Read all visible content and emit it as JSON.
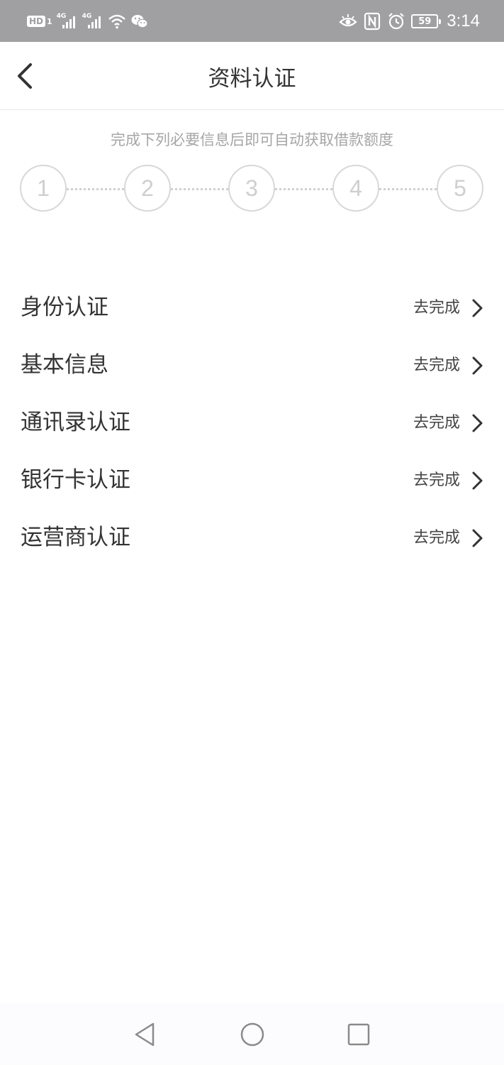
{
  "status_bar": {
    "hd_label": "HD",
    "hd_sub": "1",
    "network_1": "4G",
    "network_2": "4G",
    "battery": "59",
    "time": "3:14",
    "icons": [
      "hd-icon",
      "signal-icon",
      "signal-icon",
      "wifi-icon",
      "wechat-icon",
      "eye-icon",
      "nfc-icon",
      "alarm-icon",
      "battery-icon"
    ]
  },
  "header": {
    "title": "资料认证",
    "back_icon": "chevron-left-icon"
  },
  "hint": "完成下列必要信息后即可自动获取借款额度",
  "steps": [
    "1",
    "2",
    "3",
    "4",
    "5"
  ],
  "items": [
    {
      "label": "身份认证",
      "action": "去完成"
    },
    {
      "label": "基本信息",
      "action": "去完成"
    },
    {
      "label": "通讯录认证",
      "action": "去完成"
    },
    {
      "label": "银行卡认证",
      "action": "去完成"
    },
    {
      "label": "运营商认证",
      "action": "去完成"
    }
  ],
  "system_nav": [
    "back-triangle-icon",
    "home-circle-icon",
    "recents-square-icon"
  ],
  "colors": {
    "status_bar_bg": "#a0a0a3",
    "hint_text": "#a6a6a6",
    "step_circle": "#d8d8d8",
    "text_primary": "#333333"
  }
}
